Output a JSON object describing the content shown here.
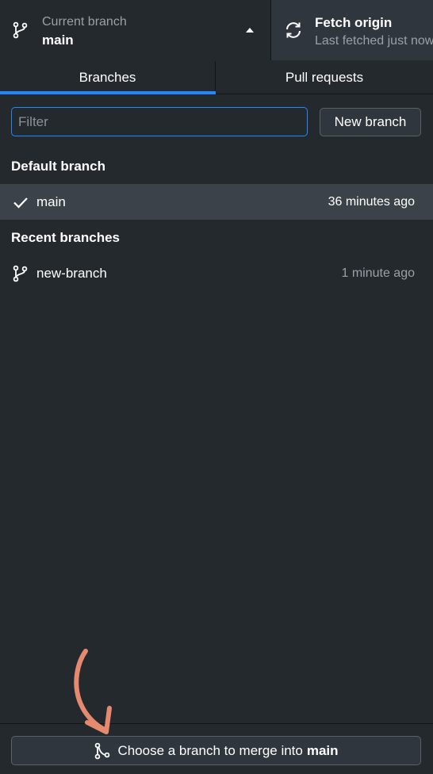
{
  "header": {
    "current_branch_label": "Current branch",
    "current_branch_value": "main",
    "fetch_title": "Fetch origin",
    "fetch_subtitle": "Last fetched just now"
  },
  "tabs": [
    {
      "label": "Branches",
      "active": true
    },
    {
      "label": "Pull requests",
      "active": false
    }
  ],
  "filter": {
    "placeholder": "Filter",
    "value": ""
  },
  "new_branch_label": "New branch",
  "default_section": {
    "title": "Default branch",
    "branches": [
      {
        "name": "main",
        "time": "36 minutes ago",
        "icon": "check-icon",
        "selected": true
      }
    ]
  },
  "recent_section": {
    "title": "Recent branches",
    "branches": [
      {
        "name": "new-branch",
        "time": "1 minute ago",
        "icon": "git-branch-icon",
        "selected": false
      }
    ]
  },
  "merge": {
    "prefix": "Choose a branch to merge into",
    "branch": "main"
  },
  "colors": {
    "background": "#24292e",
    "accent": "#2188ff",
    "selected_row": "#3b4249",
    "annotation_arrow": "#e58a6e"
  }
}
